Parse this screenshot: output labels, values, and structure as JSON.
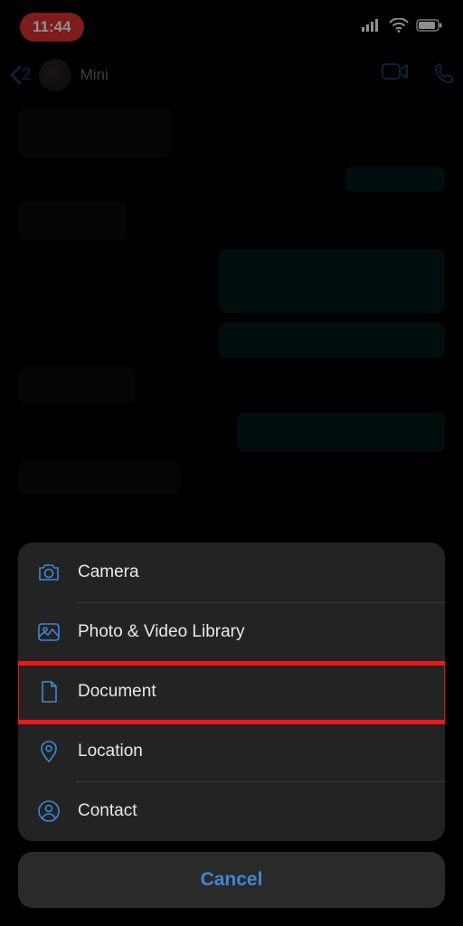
{
  "status": {
    "time": "11:44"
  },
  "header": {
    "back_count": "2",
    "contact_name": "Mini"
  },
  "sheet": {
    "items": [
      {
        "label": "Camera"
      },
      {
        "label": "Photo & Video Library"
      },
      {
        "label": "Document"
      },
      {
        "label": "Location"
      },
      {
        "label": "Contact"
      }
    ],
    "cancel_label": "Cancel",
    "highlighted_index": 2
  },
  "colors": {
    "accent": "#3e87d6",
    "highlight": "#f21616",
    "time_pill": "#e03131"
  }
}
